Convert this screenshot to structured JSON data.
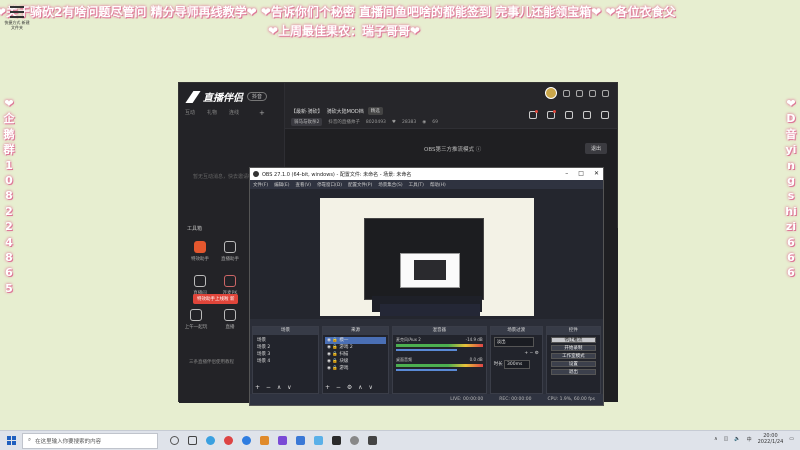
{
  "overlay": {
    "marquee": "❤关于骑砍2有啥问题尽管问 精分导师再线教学❤ ❤告诉你们个秘密 直播间鱼吧啥的都能签到 完事儿还能领宝箱❤ ❤各位衣食父",
    "subtitle": "❤上周最佳果农：瑞子哥哥❤",
    "left_vertical": "❤企鹅群108224865",
    "right_vertical": "❤D音yingshizi666",
    "desktop_icon_label": "快捷方式 新建文件夹"
  },
  "app": {
    "brand_name": "直播伴侣",
    "brand_badge": "抖音",
    "side_tabs": [
      "互动",
      "礼物",
      "连线"
    ],
    "side_empty_text": "暂无互动消息，快去邀请吧",
    "tools_title": "工具箱",
    "tools": [
      {
        "label": "特效助手",
        "color": "#e4572e"
      },
      {
        "label": "直播助手",
        "color": "#555"
      },
      {
        "label": "直播间",
        "color": "#555"
      },
      {
        "label": "连麦PK",
        "color": "#a04040"
      },
      {
        "label": "上午一起玩",
        "color": "#555"
      },
      {
        "label": "直播",
        "color": "#555"
      }
    ],
    "tip": "特效助手上线啦",
    "tip_badge": "新",
    "side_foot": "三条直播伴侣使用教程",
    "room_tag": "【最新·骑砍】",
    "room_title": "骑砍大陆MOD档",
    "room_pill": "精选",
    "room_meta_pill": "骑马与砍杀2",
    "room_meta_user": "抖音的直播帅子",
    "room_meta_id": "8020493",
    "room_meta_likes": "28383",
    "room_meta_count": "69",
    "mode_label": "OBS第三方推流模式 ⓘ",
    "exit_label": "退出"
  },
  "obs": {
    "title": "OBS 27.1.0 (64-bit, windows) - 配置文件: 未命名 - 场景: 未命名",
    "menu": [
      "文件(F)",
      "编辑(E)",
      "查看(V)",
      "停靠窗口(D)",
      "配置文件(P)",
      "场景集合(S)",
      "工具(T)",
      "帮助(H)"
    ],
    "docks": {
      "scenes": {
        "title": "场景",
        "items": [
          "场景",
          "场景 2",
          "场景 3",
          "场景 4"
        ]
      },
      "sources": {
        "title": "来源",
        "items": [
          "模一",
          "游戏 2",
          "扫描",
          "块级",
          "游戏"
        ]
      },
      "mixer": {
        "title": "混音器",
        "tracks": [
          {
            "name": "麦克风/Aux 2",
            "level": "-14.9 dB"
          },
          {
            "name": "桌面音频",
            "level": "0.0 dB"
          }
        ]
      },
      "transitions": {
        "title": "场景过渡",
        "type": "淡出",
        "duration_label": "时长",
        "duration": "300ms"
      },
      "controls": {
        "title": "控件",
        "buttons": [
          "停止推流",
          "开始录制",
          "工作室模式",
          "设置",
          "退出"
        ]
      }
    },
    "status": {
      "live": "LIVE: 00:00:00",
      "rec": "REC: 00:00:00",
      "cpu": "CPU: 1.9%, 60.00 fps"
    }
  },
  "taskbar": {
    "search_placeholder": "在这里输入你要搜索的内容",
    "time": "20:00",
    "date": "2022/1/24",
    "icons": [
      "#555",
      "#444",
      "#3aa0e0",
      "#d44",
      "#2f7de0",
      "#e08a2a",
      "#7a4ad6",
      "#3a78d6",
      "#5ab0e8",
      "#2a2a2a",
      "#888",
      "#444"
    ]
  }
}
